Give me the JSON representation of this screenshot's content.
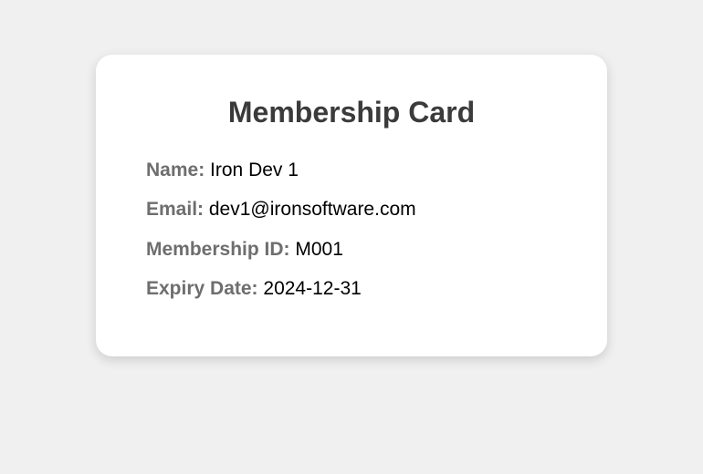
{
  "card": {
    "title": "Membership Card",
    "fields": {
      "name": {
        "label": "Name:",
        "value": "Iron Dev 1"
      },
      "email": {
        "label": "Email:",
        "value": "dev1@ironsoftware.com"
      },
      "membership_id": {
        "label": "Membership ID:",
        "value": "M001"
      },
      "expiry_date": {
        "label": "Expiry Date:",
        "value": "2024-12-31"
      }
    }
  }
}
